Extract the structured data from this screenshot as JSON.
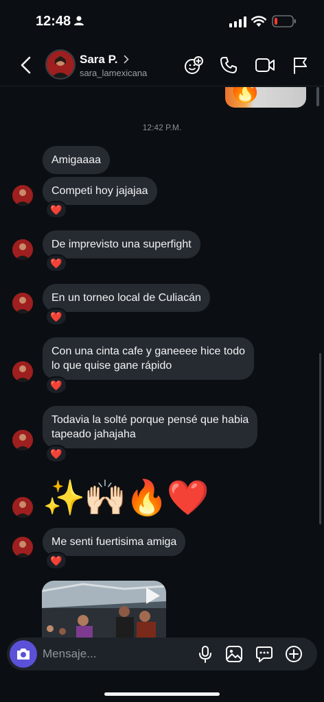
{
  "status_bar": {
    "time": "12:48",
    "battery_color": "#ff3b30"
  },
  "header": {
    "contact_name": "Sara P.",
    "contact_handle": "sara_lamexicana",
    "icons": [
      "back-chevron-icon",
      "sticker-add-icon",
      "phone-icon",
      "video-call-icon",
      "flag-icon"
    ]
  },
  "chat": {
    "timestamp": "12:42 P.M.",
    "messages": [
      {
        "text": "Amigaaaa",
        "reaction": "❤️"
      },
      {
        "text": "Competi hoy jajajaa",
        "reaction": "❤️"
      },
      {
        "text": "De imprevisto una superfight",
        "reaction": "❤️"
      },
      {
        "text": "En un torneo local de Culiacán",
        "reaction": "❤️"
      },
      {
        "text_line1": "Con una cinta cafe y ganeeee hice todo",
        "text_line2": "lo que quise gane rápido",
        "reaction": "❤️"
      },
      {
        "text_line1": "Todavia la solté porque pensé que habia",
        "text_line2": "tapeado jahajaha",
        "reaction": "❤️"
      },
      {
        "emojis": "✨🙌🏻🔥❤️"
      },
      {
        "text": "Me senti fuertisima amiga",
        "reaction": "❤️"
      }
    ]
  },
  "composer": {
    "placeholder": "Mensaje...",
    "accent_color": "#5b51d8",
    "icons": [
      "camera-icon",
      "microphone-icon",
      "gallery-icon",
      "chat-bubble-icon",
      "plus-circle-icon"
    ]
  }
}
